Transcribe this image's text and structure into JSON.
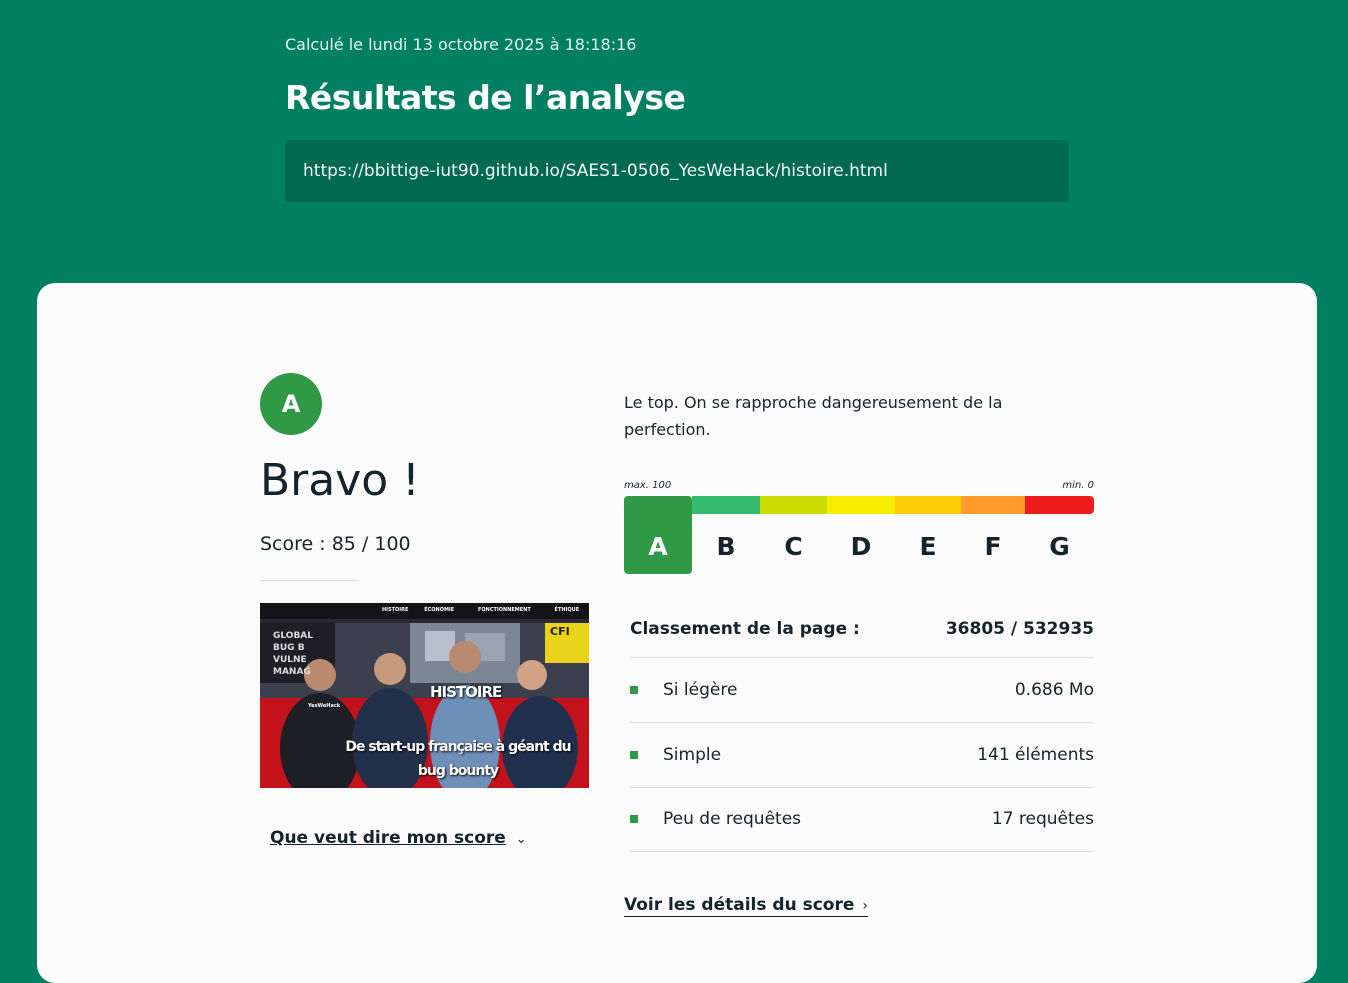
{
  "header": {
    "calculated_on": "Calculé le lundi 13 octobre 2025 à 18:18:16",
    "title": "Résultats de l’analyse",
    "url": "https://bbittige-iut90.github.io/SAES1-0506_YesWeHack/histoire.html"
  },
  "result": {
    "grade": "A",
    "headline": "Bravo !",
    "score_text": "Score : 85 / 100",
    "score": 85,
    "score_max": 100,
    "meaning_link": "Que veut dire mon score",
    "description": "Le top. On se rapproche dangereusement de la perfection."
  },
  "thumbnail": {
    "nav_items": [
      "HISTOIRE",
      "ÉCONOMIE",
      "FONCTIONNEMENT",
      "ÉTHIQUE"
    ],
    "brand": "YesWeHack",
    "banner_lines": [
      "GLOBAL",
      "BUG B",
      "VULNE",
      "MANAG"
    ],
    "section_title": "HISTOIRE",
    "caption": "De start-up française à géant du bug bounty",
    "side_text": "CFI"
  },
  "scale": {
    "max_label": "max. 100",
    "min_label": "min. 0",
    "active_grade": "A",
    "grades": [
      {
        "letter": "A",
        "color": "#2f9945"
      },
      {
        "letter": "B",
        "color": "#34bc6e"
      },
      {
        "letter": "C",
        "color": "#cadd00"
      },
      {
        "letter": "D",
        "color": "#f7ed00"
      },
      {
        "letter": "E",
        "color": "#fecd06"
      },
      {
        "letter": "F",
        "color": "#ff9b2c"
      },
      {
        "letter": "G",
        "color": "#ee1d1d"
      }
    ]
  },
  "ranking": {
    "label": "Classement de la page :",
    "value": "36805 / 532935"
  },
  "metrics": [
    {
      "label": "Si légère",
      "value": "0.686 Mo"
    },
    {
      "label": "Simple",
      "value": "141 éléments"
    },
    {
      "label": "Peu de requêtes",
      "value": "17 requêtes"
    }
  ],
  "details_link": "Voir les détails du score",
  "colors": {
    "header_bg": "#008061",
    "url_box_bg": "#006a4f",
    "grade_green": "#2f9945",
    "text_dark": "#15242b"
  }
}
